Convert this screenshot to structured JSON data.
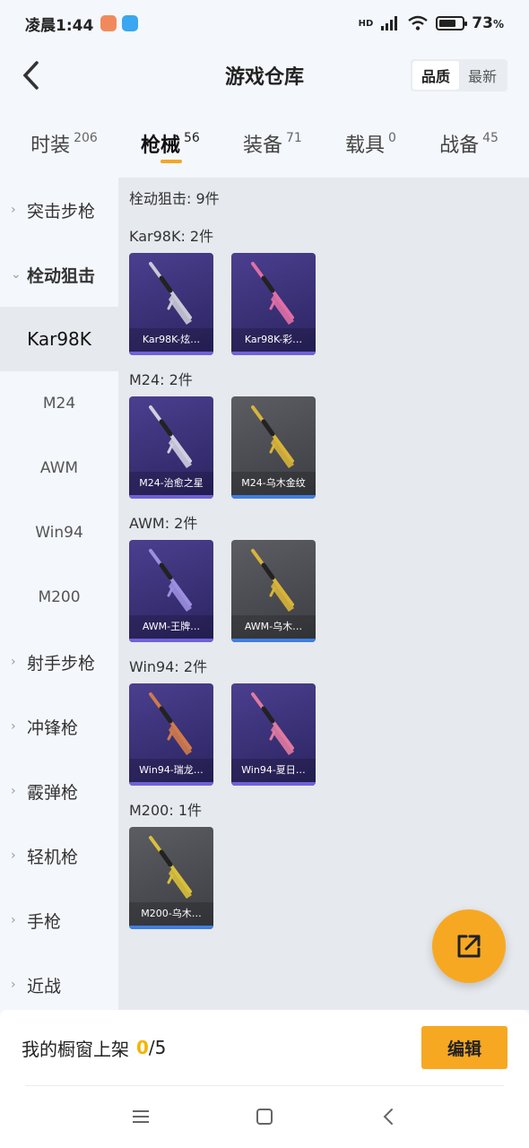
{
  "status_bar": {
    "time": "凌晨1:44",
    "battery": "73",
    "battery_unit": "%",
    "network": "HD",
    "battery_level": 0.73
  },
  "header": {
    "title": "游戏仓库",
    "sort_options": [
      "品质",
      "最新"
    ],
    "sort_active": "品质"
  },
  "tabs": [
    {
      "label": "时装",
      "count": "206"
    },
    {
      "label": "枪械",
      "count": "56"
    },
    {
      "label": "装备",
      "count": "71"
    },
    {
      "label": "载具",
      "count": "0"
    },
    {
      "label": "战备",
      "count": "45"
    }
  ],
  "sidebar": {
    "items": [
      {
        "label": "突击步枪",
        "type": "category"
      },
      {
        "label": "栓动狙击",
        "type": "category-open"
      },
      {
        "label": "Kar98K",
        "type": "sub-active"
      },
      {
        "label": "M24",
        "type": "sub"
      },
      {
        "label": "AWM",
        "type": "sub"
      },
      {
        "label": "Win94",
        "type": "sub"
      },
      {
        "label": "M200",
        "type": "sub"
      },
      {
        "label": "射手步枪",
        "type": "category"
      },
      {
        "label": "冲锋枪",
        "type": "category"
      },
      {
        "label": "霰弹枪",
        "type": "category"
      },
      {
        "label": "轻机枪",
        "type": "category"
      },
      {
        "label": "手枪",
        "type": "category"
      },
      {
        "label": "近战",
        "type": "category"
      }
    ]
  },
  "main": {
    "section_total": "栓动狙击: 9件",
    "groups": [
      {
        "title": "Kar98K: 2件",
        "items": [
          {
            "name": "Kar98K-炫…",
            "rarity": "purple",
            "gun_color": "#c9c9d6"
          },
          {
            "name": "Kar98K-彩…",
            "rarity": "purple",
            "gun_color": "#e06fa6"
          }
        ]
      },
      {
        "title": "M24: 2件",
        "items": [
          {
            "name": "M24-治愈之星",
            "rarity": "purple",
            "gun_color": "#cfcfe0"
          },
          {
            "name": "M24-乌木金纹",
            "rarity": "gray",
            "gun_color": "#d8b43a"
          }
        ]
      },
      {
        "title": "AWM: 2件",
        "items": [
          {
            "name": "AWM-王牌…",
            "rarity": "purple",
            "gun_color": "#9c8fe0"
          },
          {
            "name": "AWM-乌木…",
            "rarity": "gray",
            "gun_color": "#d8b43a"
          }
        ]
      },
      {
        "title": "Win94: 2件",
        "items": [
          {
            "name": "Win94-瑞龙…",
            "rarity": "purple",
            "gun_color": "#d07a4a"
          },
          {
            "name": "Win94-夏日…",
            "rarity": "purple",
            "gun_color": "#e07aa0"
          }
        ]
      },
      {
        "title": "M200: 1件",
        "items": [
          {
            "name": "M200-乌木…",
            "rarity": "gray",
            "gun_color": "#d8c03a"
          }
        ]
      }
    ]
  },
  "bottom_bar": {
    "label": "我的橱窗上架",
    "current": "0",
    "separator": "/",
    "max": "5",
    "edit_label": "编辑"
  },
  "colors": {
    "accent": "#f7a823",
    "purple_card": "#3b3278",
    "gray_card": "#4c4d52"
  },
  "icons": {
    "back": "back-chevron-icon",
    "fab": "share-export-icon",
    "nav_menu": "menu-icon",
    "nav_home": "home-square-icon",
    "nav_back": "back-icon"
  }
}
